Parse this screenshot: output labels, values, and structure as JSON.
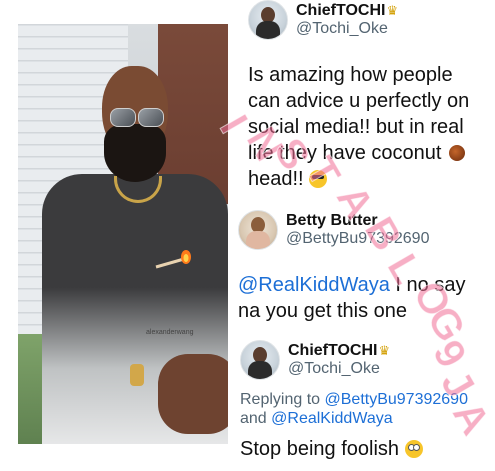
{
  "photo": {
    "brand_text": "alexanderwang"
  },
  "tweet1": {
    "display_name": "ChiefTOCHI",
    "crown_icon": "crown-emoji",
    "handle": "@Tochi_Oke",
    "text_lines": [
      "Is amazing how people",
      "can advice u perfectly on",
      "social media!! but in real",
      "life they have coconut",
      "head!!"
    ]
  },
  "tweet2": {
    "display_name": "Betty Butter",
    "handle": "@BettyBu97392690",
    "mention": "@RealKiddWaya",
    "text_rest": " I no say",
    "line2": "na you get this one"
  },
  "tweet3": {
    "display_name": "ChiefTOCHI",
    "crown_icon": "crown-emoji",
    "handle": "@Tochi_Oke",
    "replying_prefix": "Replying to ",
    "replying_to_1": "@BettyBu97392690",
    "replying_and": "and ",
    "replying_to_2": "@RealKiddWaya",
    "text": "Stop being foolish"
  },
  "watermark": {
    "letters": [
      "I",
      "N",
      "S",
      "T",
      "A",
      "B",
      "L",
      "O",
      "G",
      "9",
      "J",
      "A"
    ]
  },
  "colors": {
    "mention_blue": "#1d6fd6",
    "watermark_pink": "#f06e96",
    "handle_gray": "#536471"
  }
}
